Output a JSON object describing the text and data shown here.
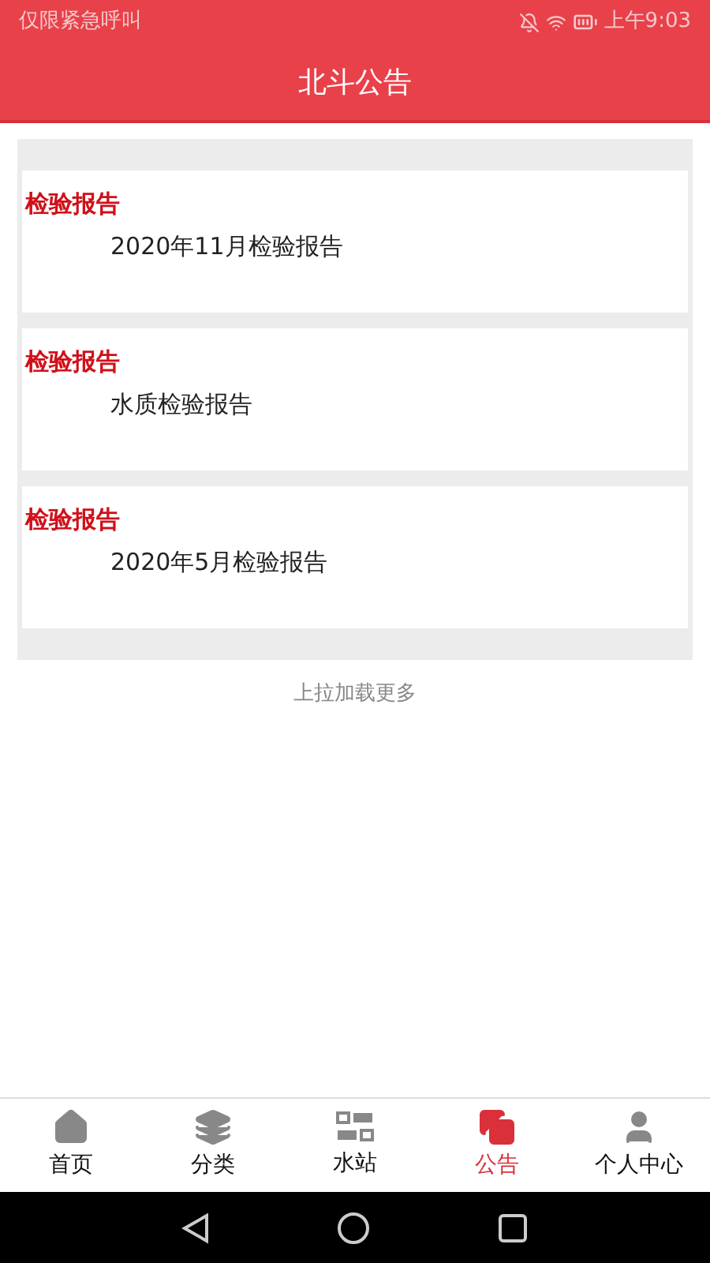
{
  "status_bar": {
    "carrier": "仅限紧急呼叫",
    "time": "上午9:03"
  },
  "header": {
    "title": "北斗公告"
  },
  "notices": [
    {
      "category": "检验报告",
      "title": "2020年11月检验报告"
    },
    {
      "category": "检验报告",
      "title": "水质检验报告"
    },
    {
      "category": "检验报告",
      "title": "2020年5月检验报告"
    }
  ],
  "load_more": "上拉加载更多",
  "tabs": [
    {
      "label": "首页",
      "kind": "home",
      "selected": false
    },
    {
      "label": "分类",
      "kind": "layers",
      "selected": false
    },
    {
      "label": "水站",
      "kind": "station",
      "selected": false
    },
    {
      "label": "公告",
      "kind": "notice",
      "selected": true
    },
    {
      "label": "个人中心",
      "kind": "user",
      "selected": false
    }
  ]
}
